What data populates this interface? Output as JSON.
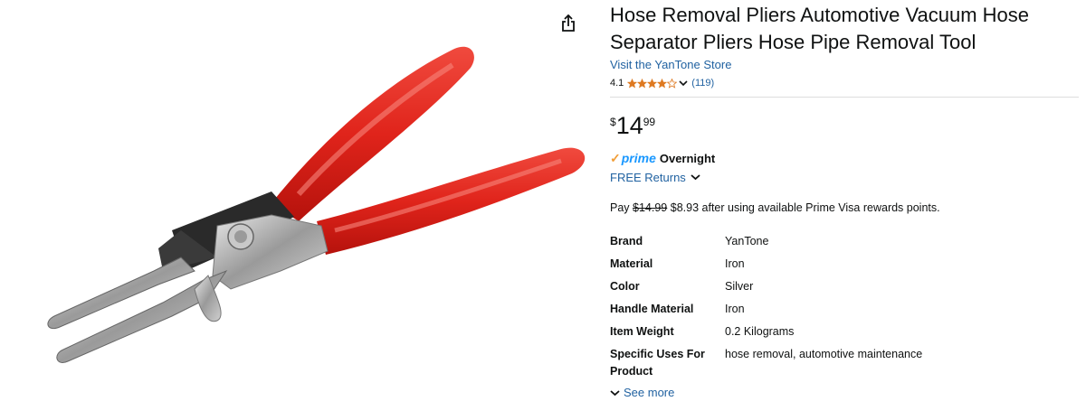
{
  "product": {
    "title": "Hose Removal Pliers Automotive Vacuum Hose Separator Pliers Hose Pipe Removal Tool",
    "store_link": "Visit the YanTone Store",
    "rating": "4.1",
    "rating_value": 4.1,
    "review_count": "(119)",
    "price": {
      "symbol": "$",
      "whole": "14",
      "fraction": "99"
    },
    "prime": {
      "check": "✓",
      "word": "prime",
      "delivery": "Overnight"
    },
    "returns": "FREE Returns",
    "visa": {
      "prefix": "Pay",
      "original_price": "$14.99",
      "discounted_price": "$8.93",
      "suffix": "after using available Prime Visa rewards points."
    },
    "specs": [
      {
        "key": "Brand",
        "value": "YanTone"
      },
      {
        "key": "Material",
        "value": "Iron"
      },
      {
        "key": "Color",
        "value": "Silver"
      },
      {
        "key": "Handle Material",
        "value": "Iron"
      },
      {
        "key": "Item Weight",
        "value": "0.2 Kilograms"
      },
      {
        "key": "Specific Uses For Product",
        "value": "hose removal, automotive maintenance"
      }
    ],
    "see_more": "See more"
  },
  "icons": {
    "share": "share-icon",
    "star": "star-icon",
    "chevron": "chevron-down-icon"
  },
  "colors": {
    "link": "#2162a1",
    "star": "#de7921",
    "prime": "#1a98ff",
    "prime_check": "#f19e38",
    "handle": "#e0241b"
  }
}
